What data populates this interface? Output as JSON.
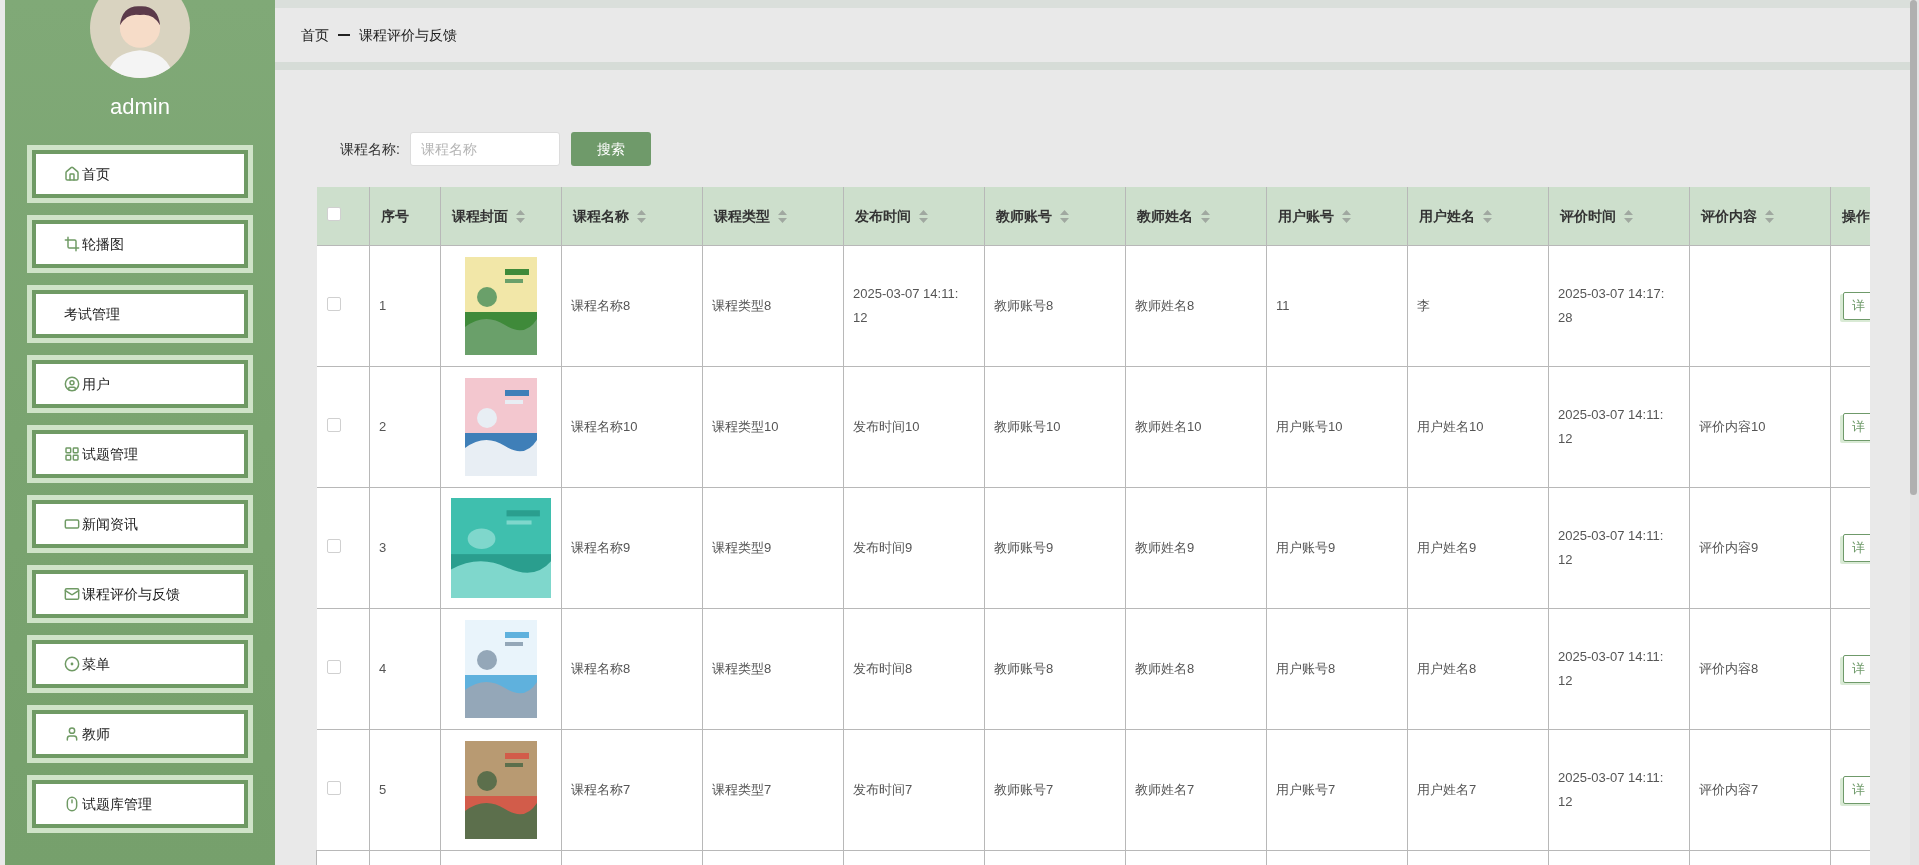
{
  "sidebar": {
    "user": "admin",
    "items": [
      {
        "label": "首页"
      },
      {
        "label": "轮播图"
      },
      {
        "label": "考试管理"
      },
      {
        "label": "用户"
      },
      {
        "label": "试题管理"
      },
      {
        "label": "新闻资讯"
      },
      {
        "label": "课程评价与反馈"
      },
      {
        "label": "菜单"
      },
      {
        "label": "教师"
      },
      {
        "label": "试题库管理"
      }
    ]
  },
  "breadcrumb": [
    "首页",
    "课程评价与反馈"
  ],
  "search": {
    "label": "课程名称:",
    "placeholder": "课程名称",
    "button": "搜索"
  },
  "table": {
    "select_all_checked": false,
    "columns": [
      {
        "label": "序号",
        "sortable": false
      },
      {
        "label": "课程封面",
        "sortable": true
      },
      {
        "label": "课程名称",
        "sortable": true
      },
      {
        "label": "课程类型",
        "sortable": true
      },
      {
        "label": "发布时间",
        "sortable": true
      },
      {
        "label": "教师账号",
        "sortable": true
      },
      {
        "label": "教师姓名",
        "sortable": true
      },
      {
        "label": "用户账号",
        "sortable": true
      },
      {
        "label": "用户姓名",
        "sortable": true
      },
      {
        "label": "评价时间",
        "sortable": true
      },
      {
        "label": "评价内容",
        "sortable": true
      },
      {
        "label": "操作"
      }
    ],
    "rows": [
      {
        "checked": false,
        "cells": [
          "1",
          {
            "kind": "picture"
          },
          "课程名称8",
          "课程类型8",
          "2025-03-07 14:11:12",
          "教师账号8",
          "教师姓名8",
          "11",
          "李",
          "2025-03-07 14:17:28",
          ""
        ],
        "action": "详"
      },
      {
        "checked": false,
        "cells": [
          "2",
          {
            "kind": "picture"
          },
          "课程名称10",
          "课程类型10",
          "发布时间10",
          "教师账号10",
          "教师姓名10",
          "用户账号10",
          "用户姓名10",
          "2025-03-07 14:11:12",
          "评价内容10"
        ],
        "action": "详"
      },
      {
        "checked": false,
        "cells": [
          "3",
          {
            "kind": "picture"
          },
          "课程名称9",
          "课程类型9",
          "发布时间9",
          "教师账号9",
          "教师姓名9",
          "用户账号9",
          "用户姓名9",
          "2025-03-07 14:11:12",
          "评价内容9"
        ],
        "action": "详"
      },
      {
        "checked": false,
        "cells": [
          "4",
          {
            "kind": "picture"
          },
          "课程名称8",
          "课程类型8",
          "发布时间8",
          "教师账号8",
          "教师姓名8",
          "用户账号8",
          "用户姓名8",
          "2025-03-07 14:11:12",
          "评价内容8"
        ],
        "action": "详"
      },
      {
        "checked": false,
        "cells": [
          "5",
          {
            "kind": "picture"
          },
          "课程名称7",
          "课程类型7",
          "发布时间7",
          "教师账号7",
          "教师姓名7",
          "用户账号7",
          "用户姓名7",
          "2025-03-07 14:11:12",
          "评价内容7"
        ],
        "action": "详"
      }
    ]
  }
}
